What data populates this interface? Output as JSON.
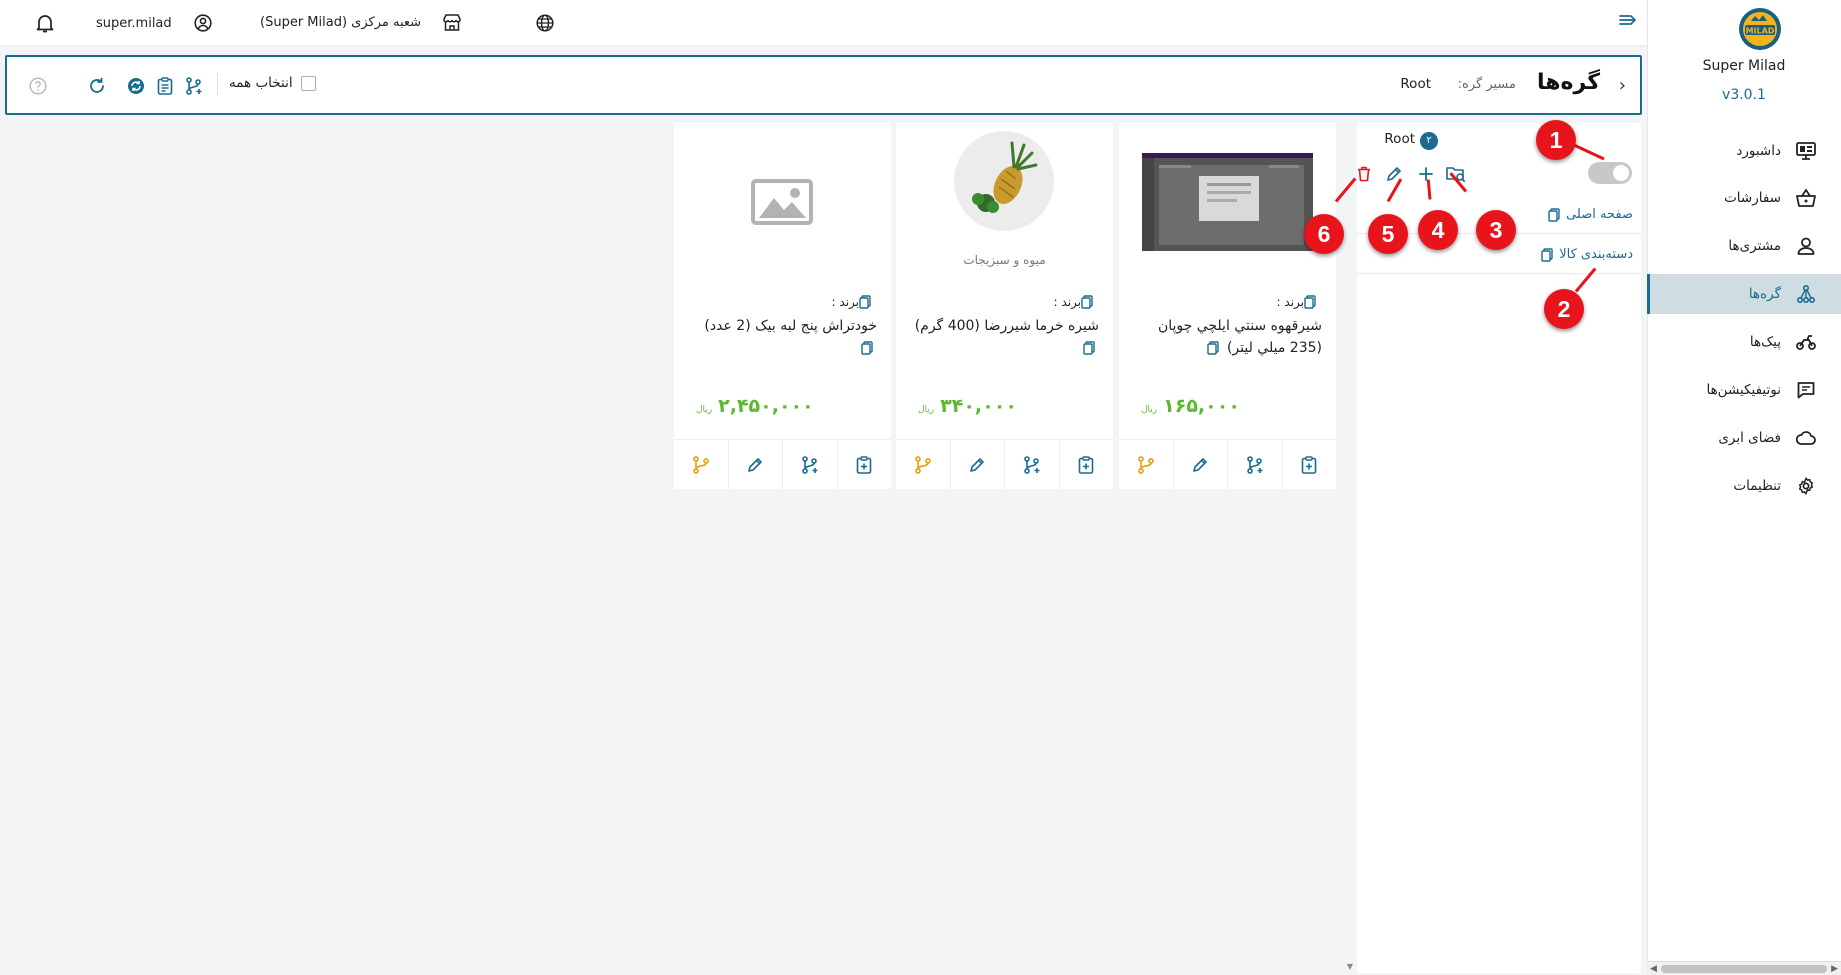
{
  "app": {
    "name": "Super Milad",
    "version": "v3.0.1",
    "logo_text": "MILAD",
    "brand_color": "#1a6b8f"
  },
  "sidebar": {
    "items": [
      {
        "label": "داشبورد",
        "icon": "dashboard-icon"
      },
      {
        "label": "سفارشات",
        "icon": "basket-icon"
      },
      {
        "label": "مشتری‌ها",
        "icon": "user-icon"
      },
      {
        "label": "گره‌ها",
        "icon": "nodes-icon",
        "active": true
      },
      {
        "label": "پیک‌ها",
        "icon": "delivery-icon"
      },
      {
        "label": "نوتیفیکیشن‌ها",
        "icon": "message-icon"
      },
      {
        "label": "فضای ابری",
        "icon": "cloud-icon"
      },
      {
        "label": "تنظیمات",
        "icon": "gear-icon"
      }
    ]
  },
  "topbar": {
    "username": "super.milad",
    "branch": "شعبه مرکزی (Super Milad)"
  },
  "header": {
    "title": "گره‌ها",
    "path_label": "مسیر گره:",
    "path_value": "Root",
    "select_all_label": "انتخاب همه"
  },
  "tree": {
    "root_label": "Root",
    "root_count": "۲",
    "items": [
      {
        "label": "صفحه اصلی"
      },
      {
        "label": "دسته‌بندی کالا"
      }
    ]
  },
  "products": [
    {
      "brand_label": "برند :",
      "name": "شیرقهوه سنتي ايلچي چوپان (235 ميلي ليتر)",
      "price": "۱۶۵,۰۰۰",
      "currency": "ریال",
      "image": "screenshot-thumbnail",
      "category": ""
    },
    {
      "brand_label": "برند :",
      "name": "شیره خرما شیررضا (400 گرم)",
      "price": "۳۴۰,۰۰۰",
      "currency": "ریال",
      "image": "fruits-vegetables-thumbnail",
      "category": "میوه و سبزیجات"
    },
    {
      "brand_label": "برند :",
      "name": "خودتراش پنج لبه بیک (2 عدد)",
      "price": "۲,۴۵۰,۰۰۰",
      "currency": "ریال",
      "image": "placeholder-image",
      "category": ""
    }
  ],
  "callouts": [
    "1",
    "2",
    "3",
    "4",
    "5",
    "6"
  ],
  "colors": {
    "accent": "#1a6b8f",
    "price": "#5cb82e",
    "danger": "#e8141c",
    "warning": "#e8a21b"
  }
}
